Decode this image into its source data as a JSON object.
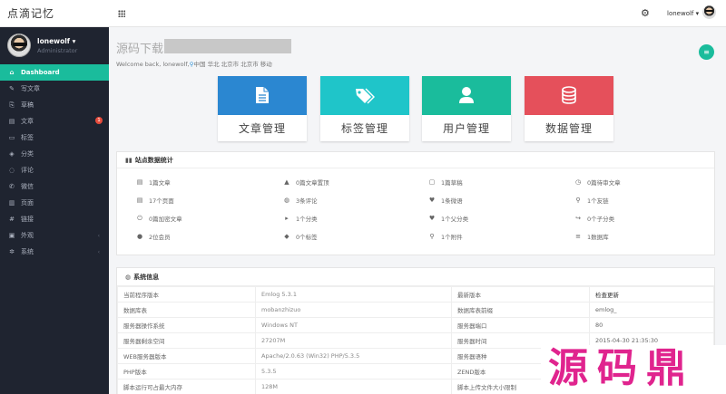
{
  "brand": "点滴记忆",
  "profile": {
    "name": "lonewolf ▾",
    "role": "Administrator"
  },
  "nav": [
    {
      "label": "Dashboard",
      "icon": "⌂",
      "active": true
    },
    {
      "label": "写文章",
      "icon": "✎"
    },
    {
      "label": "草稿",
      "icon": "⎘"
    },
    {
      "label": "文章",
      "icon": "▤",
      "badge": "1"
    },
    {
      "label": "标签",
      "icon": "▭"
    },
    {
      "label": "分类",
      "icon": "◈"
    },
    {
      "label": "评论",
      "icon": "◌"
    },
    {
      "label": "微信",
      "icon": "✆"
    },
    {
      "label": "页面",
      "icon": "▥"
    },
    {
      "label": "链接",
      "icon": "#"
    },
    {
      "label": "外观",
      "icon": "▣",
      "arrow": "‹"
    },
    {
      "label": "系统",
      "icon": "✲",
      "arrow": "‹"
    }
  ],
  "header": {
    "user": "lonewolf ▾"
  },
  "page": {
    "title": "源码下载:",
    "welcome": "Welcome back, lonewolf,",
    "location": "中国 华北 北京市 北京市 移动"
  },
  "tiles": [
    {
      "label": "文章管理",
      "color": "#2b87d1"
    },
    {
      "label": "标签管理",
      "color": "#1fc5c9"
    },
    {
      "label": "用户管理",
      "color": "#1abc9c"
    },
    {
      "label": "数据管理",
      "color": "#e5505b"
    }
  ],
  "stats": {
    "title": "站点数据统计",
    "items": [
      {
        "text": "1篇文章",
        "icon": "▤"
      },
      {
        "text": "0篇文章置顶",
        "icon": "▲"
      },
      {
        "text": "1篇草稿",
        "icon": "▢"
      },
      {
        "text": "0篇待审文章",
        "icon": "◷"
      },
      {
        "text": "17个页面",
        "icon": "▤"
      },
      {
        "text": "3条评论",
        "icon": "◍"
      },
      {
        "text": "1条微语",
        "icon": "♥"
      },
      {
        "text": "1个友链",
        "icon": "⚲"
      },
      {
        "text": "0篇加密文章",
        "icon": "⏻"
      },
      {
        "text": "1个分类",
        "icon": "▸"
      },
      {
        "text": "1个父分类",
        "icon": "♥"
      },
      {
        "text": "0个子分类",
        "icon": "↪"
      },
      {
        "text": "2位会员",
        "icon": "●"
      },
      {
        "text": "0个标签",
        "icon": "◆"
      },
      {
        "text": "1个附件",
        "icon": "⚲"
      },
      {
        "text": "1数据库",
        "icon": "≡"
      }
    ]
  },
  "sysinfo": {
    "title": "系统信息",
    "rows": [
      [
        "当前程序版本",
        "Emlog 5.3.1",
        "最新版本",
        "检查更新"
      ],
      [
        "数据库表",
        "mobanzhizuo",
        "数据库表前缀",
        "emlog_"
      ],
      [
        "服务器操作系统",
        "Windows NT",
        "服务器端口",
        "80"
      ],
      [
        "服务器剩余空间",
        "27207M",
        "服务器时间",
        "2015-04-30 21:35:30"
      ],
      [
        "WEB服务器版本",
        "Apache/2.0.63 (Win32) PHP/5.3.5",
        "服务器语种",
        ""
      ],
      [
        "PHP版本",
        "5.3.5",
        "ZEND版本",
        ""
      ],
      [
        "脚本运行可占最大内存",
        "128M",
        "脚本上传文件大小限制",
        ""
      ]
    ]
  },
  "watermark": "源码鼎"
}
